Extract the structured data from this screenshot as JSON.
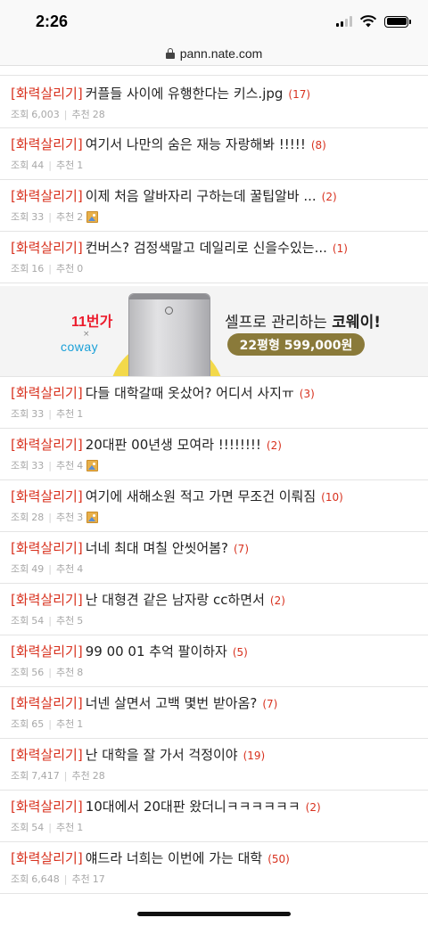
{
  "status": {
    "time": "2:26"
  },
  "browser": {
    "url": "pann.nate.com"
  },
  "labels": {
    "views": "조회",
    "recommend": "추천"
  },
  "posts_top": [
    {
      "tag": "[화력살리기]",
      "title": "커플들 사이에 유행한다는 키스.jpg",
      "count": "(17)",
      "views": "6,003",
      "recommend": "28",
      "has_image": false
    },
    {
      "tag": "[화력살리기]",
      "title": "여기서 나만의 숨은 재능 자랑해봐 !!!!!",
      "count": "(8)",
      "views": "44",
      "recommend": "1",
      "has_image": false
    },
    {
      "tag": "[화력살리기]",
      "title": "이제 처음 알바자리 구하는데 꿀팁알바 ...",
      "count": "(2)",
      "views": "33",
      "recommend": "2",
      "has_image": true
    },
    {
      "tag": "[화력살리기]",
      "title": "컨버스? 검정색말고 데일리로 신을수있는...",
      "count": "(1)",
      "views": "16",
      "recommend": "0",
      "has_image": false
    }
  ],
  "ad": {
    "brand1": "11번가",
    "x": "×",
    "brand2": "coway",
    "headline_prefix": "셀프로 관리하는 ",
    "headline_brand": "코웨이!",
    "price": "22평형 599,000원"
  },
  "posts_bottom": [
    {
      "tag": "[화력살리기]",
      "title": "다들 대학갈때 옷샀어? 어디서 사지ㅠ",
      "count": "(3)",
      "views": "33",
      "recommend": "1",
      "has_image": false
    },
    {
      "tag": "[화력살리기]",
      "title": "20대판 00년생 모여라 !!!!!!!!",
      "count": "(2)",
      "views": "33",
      "recommend": "4",
      "has_image": true
    },
    {
      "tag": "[화력살리기]",
      "title": "여기에 새해소원 적고 가면 무조건 이뤄짐",
      "count": "(10)",
      "views": "28",
      "recommend": "3",
      "has_image": true
    },
    {
      "tag": "[화력살리기]",
      "title": "너네 최대 며칠 안씻어봄?",
      "count": "(7)",
      "views": "49",
      "recommend": "4",
      "has_image": false
    },
    {
      "tag": "[화력살리기]",
      "title": "난 대형견 같은 남자랑 cc하면서",
      "count": "(2)",
      "views": "54",
      "recommend": "5",
      "has_image": false
    },
    {
      "tag": "[화력살리기]",
      "title": "99 00 01 추억 팔이하자",
      "count": "(5)",
      "views": "56",
      "recommend": "8",
      "has_image": false
    },
    {
      "tag": "[화력살리기]",
      "title": "너넨 살면서 고백 몇번 받아옴?",
      "count": "(7)",
      "views": "65",
      "recommend": "1",
      "has_image": false
    },
    {
      "tag": "[화력살리기]",
      "title": "난 대학을 잘 가서 걱정이야",
      "count": "(19)",
      "views": "7,417",
      "recommend": "28",
      "has_image": false
    },
    {
      "tag": "[화력살리기]",
      "title": "10대에서 20대판 왔더니ㅋㅋㅋㅋㅋㅋ",
      "count": "(2)",
      "views": "54",
      "recommend": "1",
      "has_image": false
    },
    {
      "tag": "[화력살리기]",
      "title": "얘드라 너희는 이번에 가는 대학",
      "count": "(50)",
      "views": "6,648",
      "recommend": "17",
      "has_image": false
    }
  ]
}
